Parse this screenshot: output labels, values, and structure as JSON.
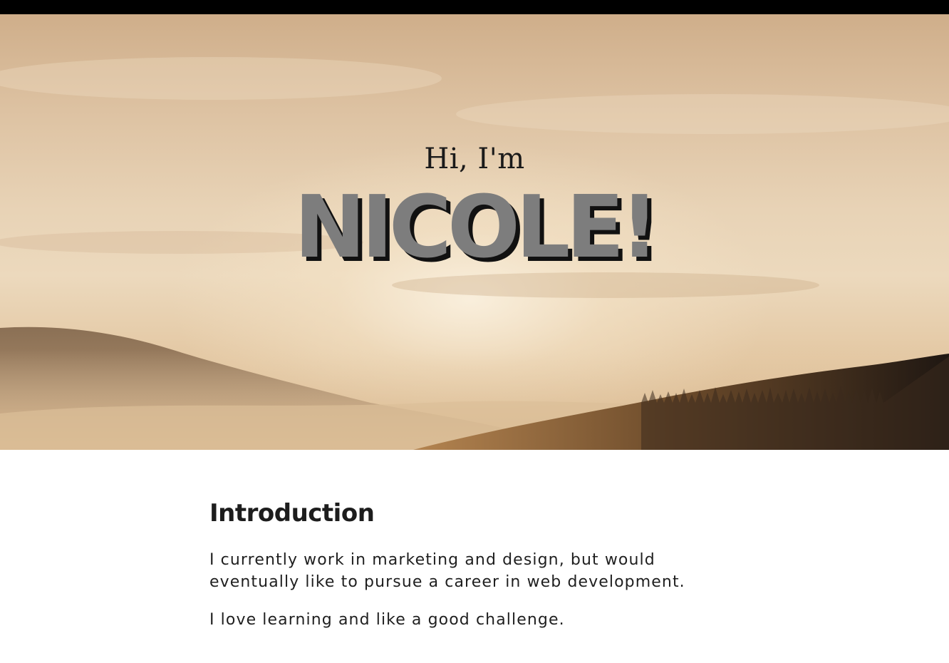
{
  "hero": {
    "greeting": "Hi, I'm",
    "name": "NICOLE!"
  },
  "intro": {
    "heading": "Introduction",
    "paragraphs": [
      "I currently work in marketing and design, but would eventually like to pursue a career in web development.",
      "I love learning and like a good challenge."
    ]
  },
  "colors": {
    "top_bar": "#000000",
    "name_fill": "#7d7d7d",
    "name_shadow": "#111111",
    "text": "#1f1f1f"
  }
}
